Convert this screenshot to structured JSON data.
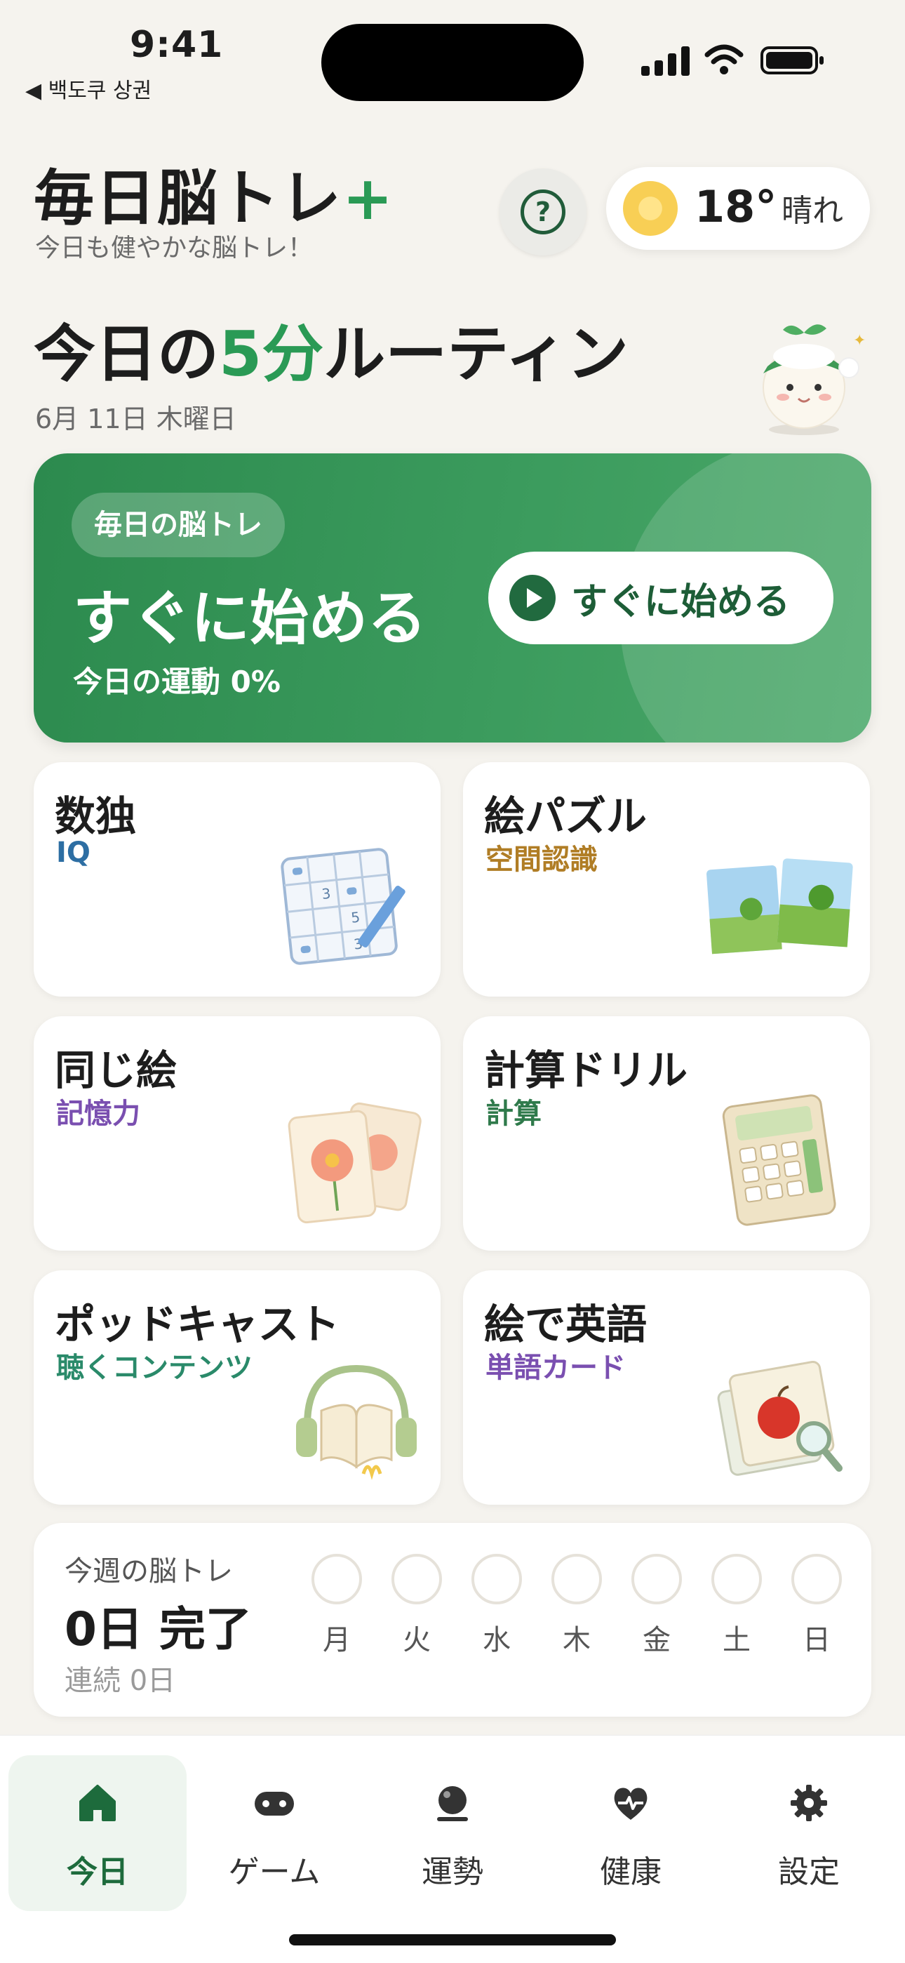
{
  "status_bar": {
    "time": "9:41",
    "back_label": "◀ 백도쿠 상권"
  },
  "header": {
    "app_title": "毎日脳トレ",
    "app_title_plus": "+",
    "subtitle": "今日も健やかな脳トレ！",
    "help_icon": "?",
    "weather": {
      "icon": "sun-icon",
      "temperature": "18°",
      "condition": "晴れ"
    }
  },
  "routine": {
    "prefix": "今日の",
    "highlight": "5分",
    "suffix": "ルーティン",
    "date": "6月 11日 木曜日"
  },
  "hero": {
    "pill": "毎日の脳トレ",
    "title": "すぐに始める",
    "progress": "今日の運動 0%",
    "button_label": "すぐに始める"
  },
  "games": [
    {
      "title": "数独",
      "subtitle": "IQ",
      "subtitle_color": "#2d6ea3"
    },
    {
      "title": "絵パズル",
      "subtitle": "空間認識",
      "subtitle_color": "#b07d25"
    },
    {
      "title": "同じ絵",
      "subtitle": "記憶力",
      "subtitle_color": "#7a4fb0"
    },
    {
      "title": "計算ドリル",
      "subtitle": "計算",
      "subtitle_color": "#2f7a4b"
    },
    {
      "title": "ポッドキャスト",
      "subtitle": "聴くコンテンツ",
      "subtitle_color": "#2a8a6a"
    },
    {
      "title": "絵で英語",
      "subtitle": "単語カード",
      "subtitle_color": "#7a4fb0"
    }
  ],
  "week": {
    "label": "今週の脳トレ",
    "count": "0日 完了",
    "streak": "連続 0日",
    "days": [
      "月",
      "火",
      "水",
      "木",
      "金",
      "土",
      "日"
    ]
  },
  "tabs": [
    {
      "label": "今日",
      "icon": "home-icon",
      "active": true
    },
    {
      "label": "ゲーム",
      "icon": "gamepad-icon",
      "active": false
    },
    {
      "label": "運勢",
      "icon": "crystal-ball-icon",
      "active": false
    },
    {
      "label": "健康",
      "icon": "heart-pulse-icon",
      "active": false
    },
    {
      "label": "設定",
      "icon": "gear-icon",
      "active": false
    }
  ],
  "colors": {
    "accent": "#2a9a55",
    "hero": "#3b9b5d",
    "background": "#f5f3ee"
  }
}
